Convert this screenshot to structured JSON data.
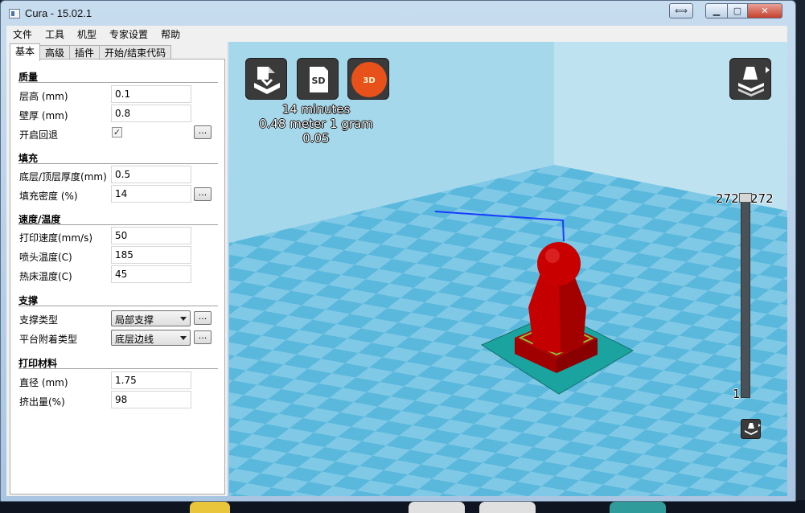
{
  "window": {
    "title": "Cura - 15.02.1"
  },
  "menu": [
    "文件",
    "工具",
    "机型",
    "专家设置",
    "帮助"
  ],
  "tabs": [
    "基本",
    "高级",
    "插件",
    "开始/结束代码"
  ],
  "sections": {
    "quality": {
      "title": "质量",
      "layer_height": {
        "label": "层高 (mm)",
        "value": "0.1"
      },
      "shell_thickness": {
        "label": "壁厚 (mm)",
        "value": "0.8"
      },
      "retraction": {
        "label": "开启回退",
        "checked": true,
        "more": "..."
      }
    },
    "fill": {
      "title": "填充",
      "bottom_top": {
        "label": "底层/顶层厚度(mm)",
        "value": "0.5"
      },
      "density": {
        "label": "填充密度 (%)",
        "value": "14",
        "more": "..."
      }
    },
    "speed": {
      "title": "速度/温度",
      "print_speed": {
        "label": "打印速度(mm/s)",
        "value": "50"
      },
      "nozzle_temp": {
        "label": "喷头温度(C)",
        "value": "185"
      },
      "bed_temp": {
        "label": "热床温度(C)",
        "value": "45"
      }
    },
    "support": {
      "title": "支撑",
      "support_type": {
        "label": "支撑类型",
        "value": "局部支撑",
        "more": "..."
      },
      "adhesion": {
        "label": "平台附着类型",
        "value": "底层边线",
        "more": "..."
      }
    },
    "filament": {
      "title": "打印材料",
      "diameter": {
        "label": "直径 (mm)",
        "value": "1.75"
      },
      "flow": {
        "label": "挤出量(%)",
        "value": "98"
      }
    }
  },
  "viewport": {
    "stats": {
      "time": "14 minutes",
      "material": "0.48 meter 1 gram",
      "cost": "0.05"
    },
    "layer_top_left": "272",
    "layer_top_right": "272",
    "layer_bottom": "1",
    "load_icon": "load-model-icon",
    "sd_label": "SD",
    "logo_text": "3D",
    "view_mode_icon": "view-mode-icon",
    "colors": {
      "floor_light": "#5ab8dc",
      "floor_dark": "#7fc9e6",
      "model": "#c40000",
      "brim": "#1ba3a0"
    }
  }
}
